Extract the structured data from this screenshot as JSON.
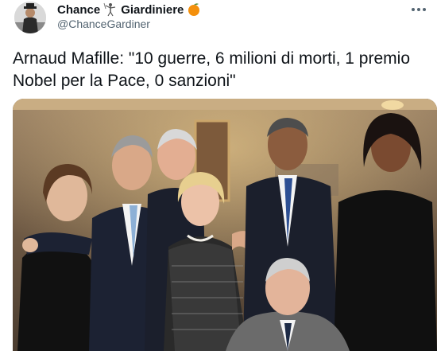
{
  "author": {
    "display_name_part1": "Chance",
    "display_name_part2": "Giardiniere",
    "handle": "@ChanceGardiner",
    "avatar_icon": "gardener-avatar",
    "badge_icon": "orange-fruit-icon",
    "separator_icon": "gardener-figure-icon"
  },
  "tweet": {
    "text": "Arnaud Mafille: \"10 guerre, 6 milioni di morti, 1 premio\nNobel per la Pace, 0 sanzioni\""
  },
  "menu": {
    "icon": "more-icon"
  },
  "colors": {
    "text": "#0f1419",
    "secondary": "#536471",
    "badge": "#f4900c"
  }
}
